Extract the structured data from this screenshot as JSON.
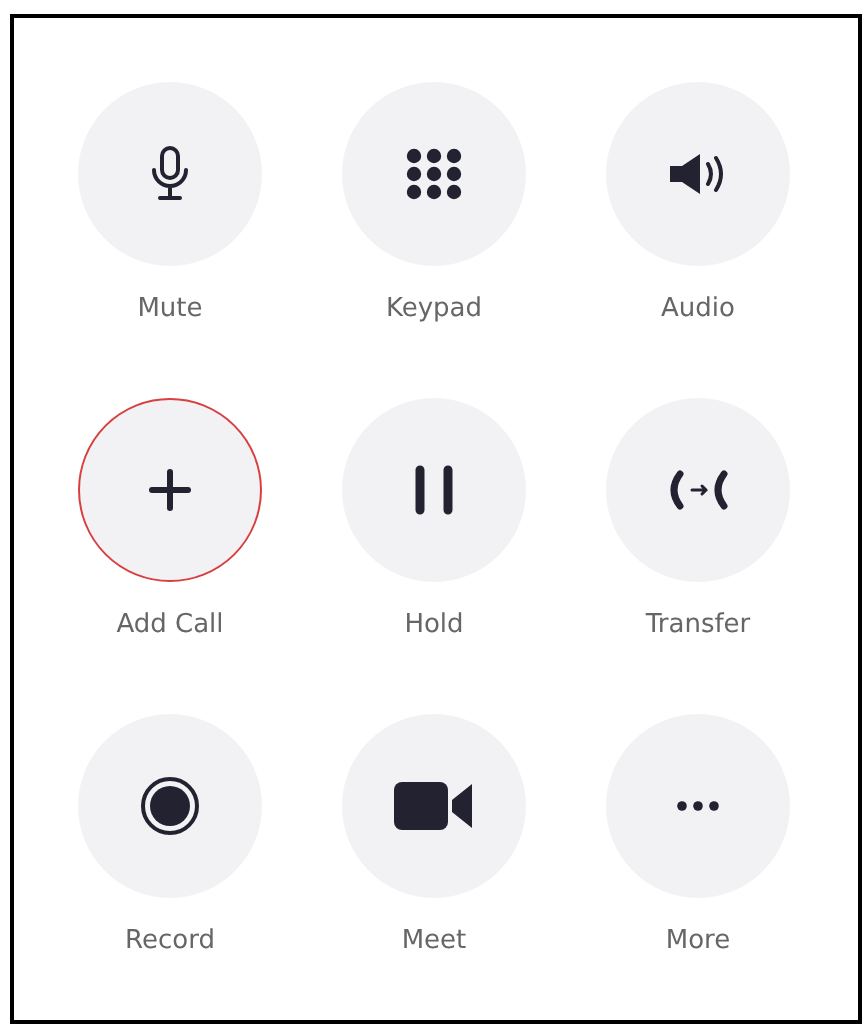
{
  "buttons": [
    {
      "kind": "mute",
      "label": "Mute",
      "focused": false
    },
    {
      "kind": "keypad",
      "label": "Keypad",
      "focused": false
    },
    {
      "kind": "audio",
      "label": "Audio",
      "focused": false
    },
    {
      "kind": "add",
      "label": "Add Call",
      "focused": true
    },
    {
      "kind": "hold",
      "label": "Hold",
      "focused": false
    },
    {
      "kind": "transfer",
      "label": "Transfer",
      "focused": false
    },
    {
      "kind": "record",
      "label": "Record",
      "focused": false
    },
    {
      "kind": "meet",
      "label": "Meet",
      "focused": false
    },
    {
      "kind": "more",
      "label": "More",
      "focused": false
    }
  ]
}
